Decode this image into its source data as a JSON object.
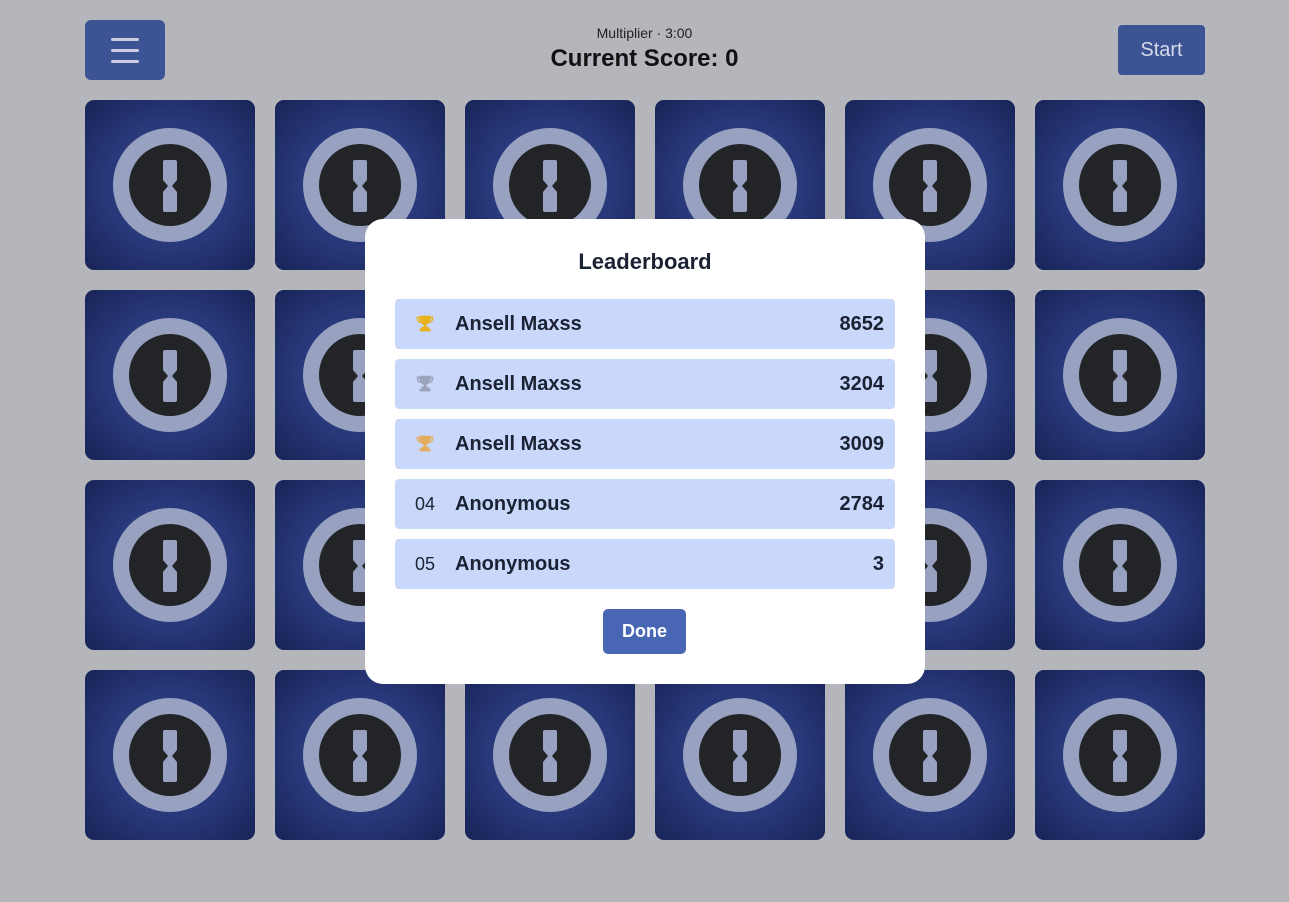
{
  "header": {
    "menu_icon": "hamburger-menu-icon",
    "subtitle": "Multiplier · 3:00",
    "score_label": "Current Score: 0",
    "start_label": "Start"
  },
  "board": {
    "card_icon": "keyhole-lock-icon",
    "rows": 4,
    "columns": 6
  },
  "leaderboard": {
    "title": "Leaderboard",
    "entries": [
      {
        "rank": "01",
        "rank_icon": "gold-trophy-icon",
        "name": "Ansell Maxss",
        "score": "8652"
      },
      {
        "rank": "02",
        "rank_icon": "silver-trophy-icon",
        "name": "Ansell Maxss",
        "score": "3204"
      },
      {
        "rank": "03",
        "rank_icon": "bronze-trophy-icon",
        "name": "Ansell Maxss",
        "score": "3009"
      },
      {
        "rank": "04",
        "rank_icon": "",
        "name": "Anonymous",
        "score": "2784"
      },
      {
        "rank": "05",
        "rank_icon": "",
        "name": "Anonymous",
        "score": "3"
      }
    ],
    "done_label": "Done"
  },
  "colors": {
    "background": "#b5b6bb",
    "primary_button": "#3c5394",
    "done_button": "#4866b4",
    "row_background": "#c9d7fb",
    "gold": "#e8b21b",
    "silver": "#9aa3ba",
    "bronze": "#e3ad5d"
  }
}
